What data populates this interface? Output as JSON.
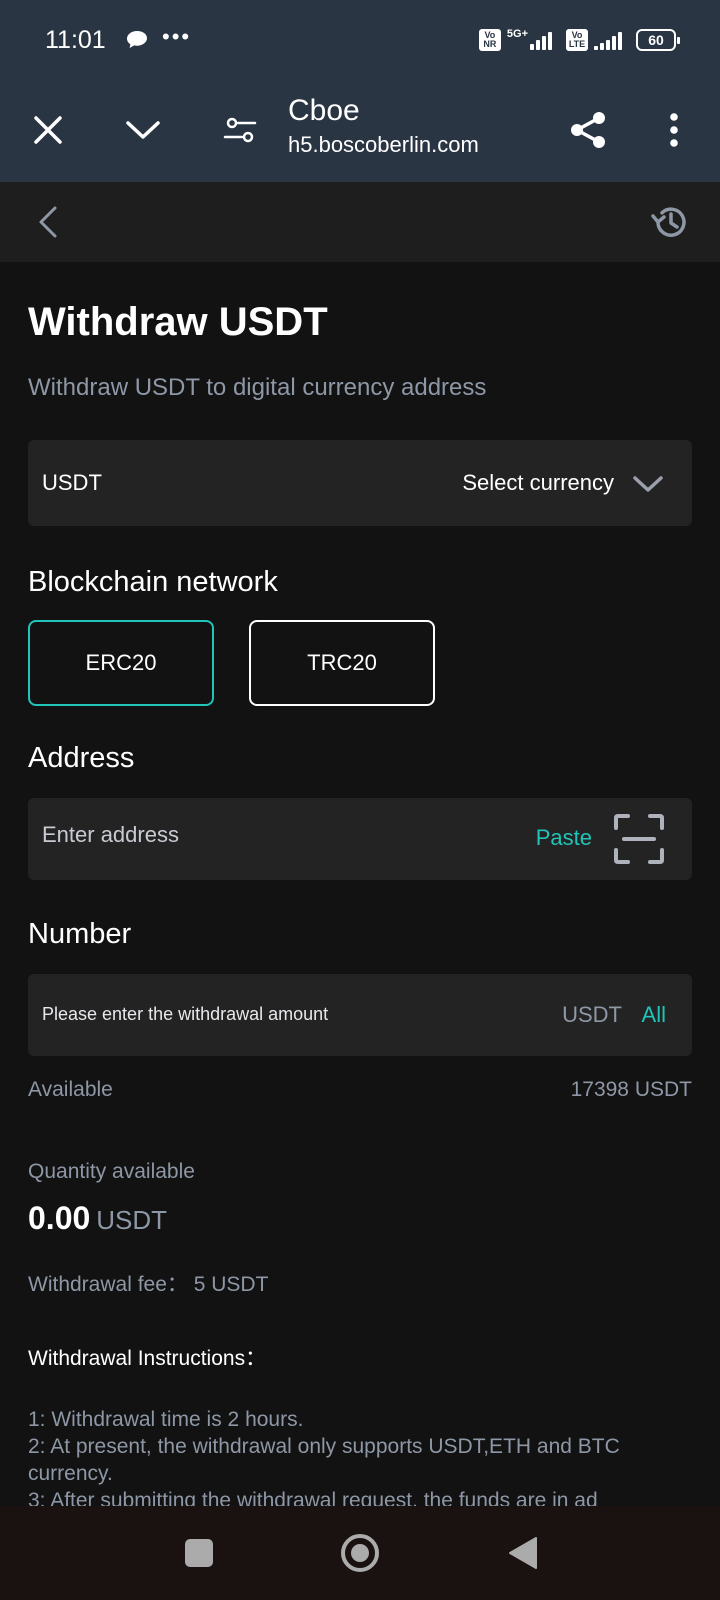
{
  "status_bar": {
    "time": "11:01",
    "dots": "•••",
    "network_badge_1": "Vo NR",
    "network_5g": "5G+",
    "network_badge_2": "Vo LTE",
    "battery": "60"
  },
  "browser": {
    "title": "Cboe",
    "url": "h5.boscoberlin.com"
  },
  "page": {
    "title": "Withdraw USDT",
    "subtitle": "Withdraw USDT to digital currency address"
  },
  "currency": {
    "value": "USDT",
    "select_label": "Select currency"
  },
  "network": {
    "label": "Blockchain network",
    "options": [
      {
        "label": "ERC20",
        "selected": true
      },
      {
        "label": "TRC20",
        "selected": false
      }
    ]
  },
  "address": {
    "label": "Address",
    "placeholder": "Enter address",
    "value": "",
    "paste_label": "Paste"
  },
  "number": {
    "label": "Number",
    "placeholder": "Please enter the withdrawal amount",
    "value": "",
    "unit": "USDT",
    "all_label": "All"
  },
  "available": {
    "label": "Available",
    "value": "17398 USDT"
  },
  "quantity": {
    "label": "Quantity available",
    "value": "0.00",
    "unit": "USDT"
  },
  "fee": {
    "text": "Withdrawal fee： 5 USDT"
  },
  "instructions": {
    "title": "Withdrawal Instructions：",
    "lines": [
      "1: Withdrawal time is 2 hours.",
      "2: At present, the withdrawal only supports USDT,ETH and BTC currency.",
      "3: After submitting the withdrawal request, the funds are in ad"
    ]
  },
  "colors": {
    "accent": "#20c4b8",
    "chrome_bg": "#2a3544",
    "page_bg": "#121212",
    "card_bg": "#232323",
    "muted_text": "#8e97a6"
  }
}
